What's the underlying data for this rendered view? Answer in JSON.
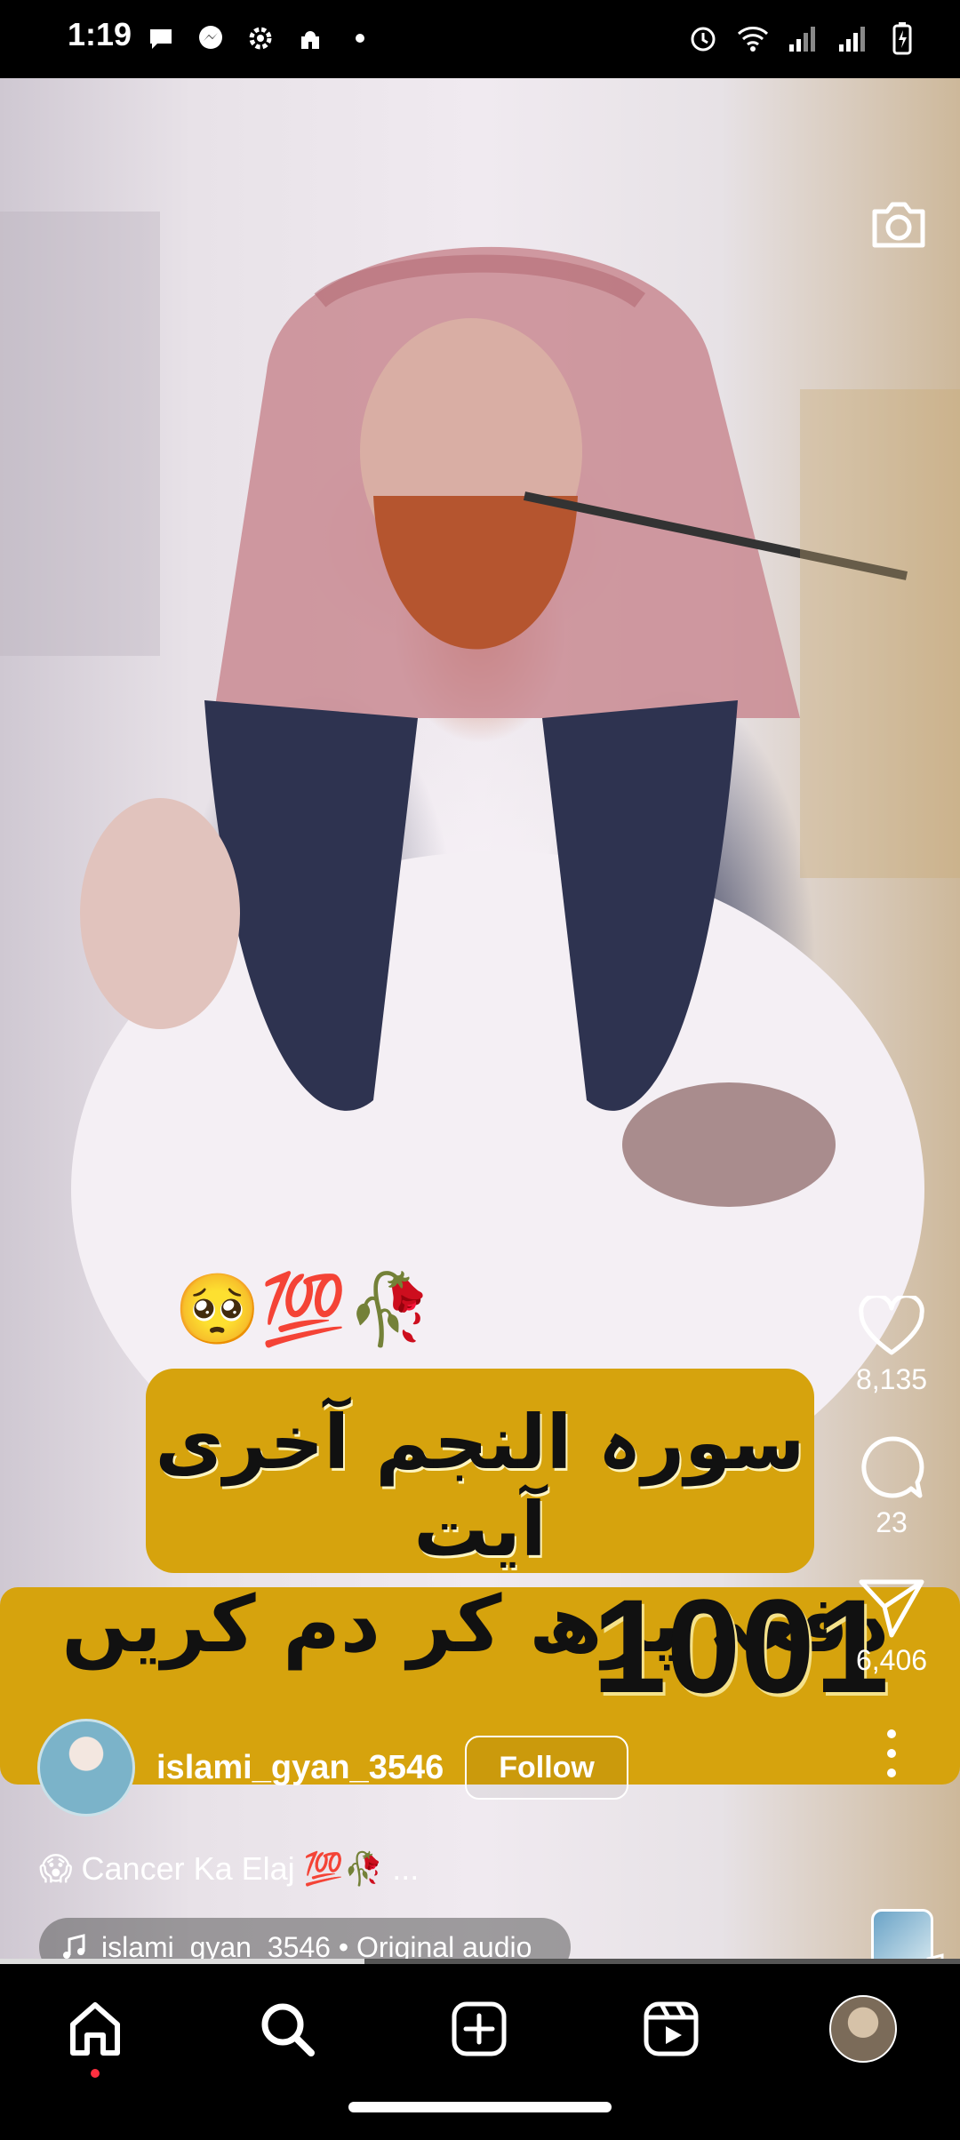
{
  "status_bar": {
    "time": "1:19",
    "left_icons": [
      "chat-bubble-icon",
      "messenger-icon",
      "settings-icon",
      "mosque-icon",
      "dot-icon"
    ],
    "right_icons": [
      "alarm-icon",
      "wifi-icon",
      "signal-icon",
      "signal-icon",
      "battery-charging-icon"
    ]
  },
  "reel": {
    "overlay_emojis": "🥺💯🥀",
    "text_line_1": "سورہ النجم آخری آیت",
    "text_line_2": "دفعہ پڑھ کر دم کریں",
    "text_number": "1001",
    "author": {
      "username": "islami_gyan_3546",
      "follow_label": "Follow"
    },
    "caption": {
      "emoji": "😱",
      "text": "Cancer Ka Elaj 💯🥀 ..."
    },
    "audio": {
      "label": "islami_gyan_3546 • Original audio"
    },
    "actions": {
      "likes": "8,135",
      "comments": "23",
      "shares": "6,406"
    },
    "progress_fraction": 0.38
  },
  "bottom_nav": {
    "items": [
      "home-icon",
      "search-icon",
      "create-icon",
      "reels-icon",
      "profile-avatar"
    ],
    "active": "home-icon"
  },
  "colors": {
    "text_card": "#d6a30d",
    "notification_dot": "#ff3040"
  }
}
